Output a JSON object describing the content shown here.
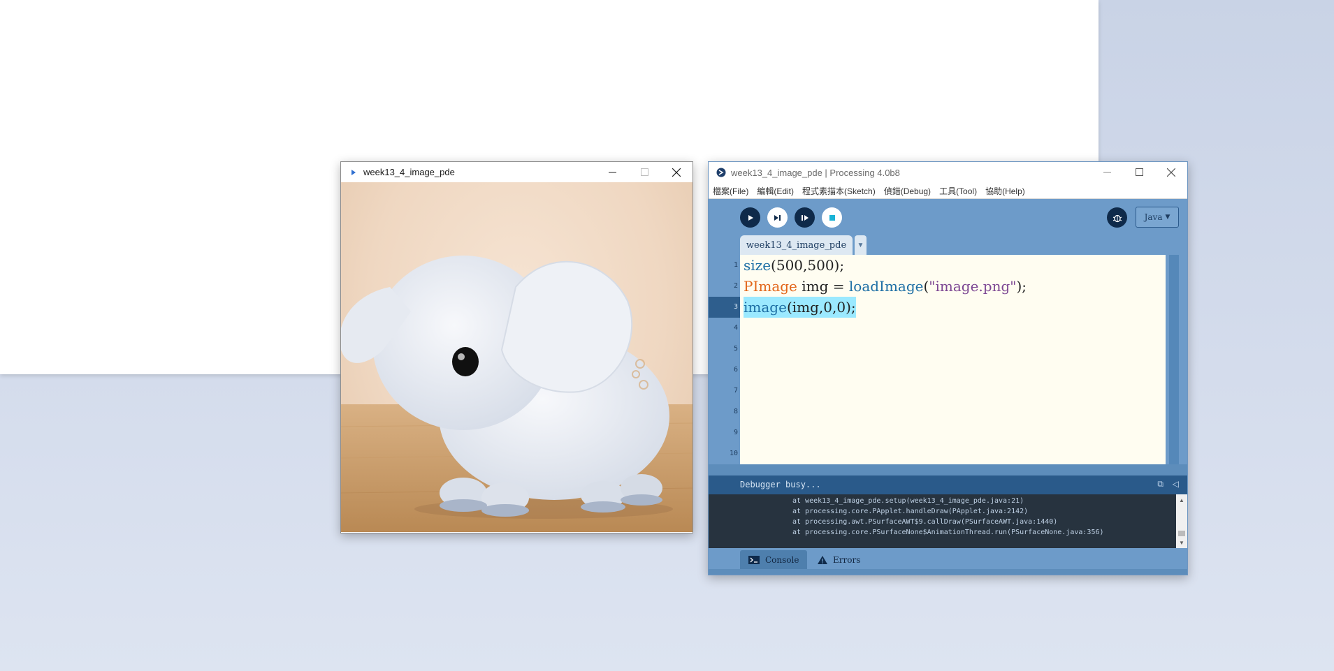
{
  "sketch_window": {
    "title": "week13_4_image_pde",
    "image_alt": "white plush elephant toy on a wooden floor"
  },
  "ide_window": {
    "title": "week13_4_image_pde | Processing 4.0b8",
    "menus": [
      "檔案(File)",
      "編輯(Edit)",
      "程式素描本(Sketch)",
      "偵錯(Debug)",
      "工具(Tool)",
      "協助(Help)"
    ],
    "mode_label": "Java",
    "tab_label": "week13_4_image_pde",
    "code_lines": [
      {
        "num": "1",
        "parts": [
          {
            "t": "size",
            "c": "kw-fn"
          },
          {
            "t": "(500,500);",
            "c": ""
          }
        ]
      },
      {
        "num": "2",
        "parts": [
          {
            "t": "PImage",
            "c": "kw-type"
          },
          {
            "t": " img = ",
            "c": ""
          },
          {
            "t": "loadImage",
            "c": "kw-fn"
          },
          {
            "t": "(",
            "c": ""
          },
          {
            "t": "\"image.png\"",
            "c": "str"
          },
          {
            "t": ");",
            "c": ""
          }
        ]
      },
      {
        "num": "3",
        "parts": [
          {
            "t": "image",
            "c": "kw-fn"
          },
          {
            "t": "(img,0,0);",
            "c": ""
          }
        ],
        "selected": true
      },
      {
        "num": "4",
        "parts": []
      },
      {
        "num": "5",
        "parts": []
      },
      {
        "num": "6",
        "parts": []
      },
      {
        "num": "7",
        "parts": []
      },
      {
        "num": "8",
        "parts": []
      },
      {
        "num": "9",
        "parts": []
      },
      {
        "num": "10",
        "parts": []
      }
    ],
    "status_text": "Debugger busy...",
    "console_lines": [
      "at week13_4_image_pde.setup(week13_4_image_pde.java:21)",
      "at processing.core.PApplet.handleDraw(PApplet.java:2142)",
      "at processing.awt.PSurfaceAWT$9.callDraw(PSurfaceAWT.java:1440)",
      "at processing.core.PSurfaceNone$AnimationThread.run(PSurfaceNone.java:356)"
    ],
    "footer_tabs": {
      "console": "Console",
      "errors": "Errors"
    }
  },
  "colors": {
    "ide_blue": "#6d9bc9",
    "toolbar_dark": "#0f2a4a",
    "selection": "#9be9ff",
    "keyword_fn": "#1e6fa5",
    "keyword_type": "#e2661a",
    "string": "#7d4793"
  }
}
